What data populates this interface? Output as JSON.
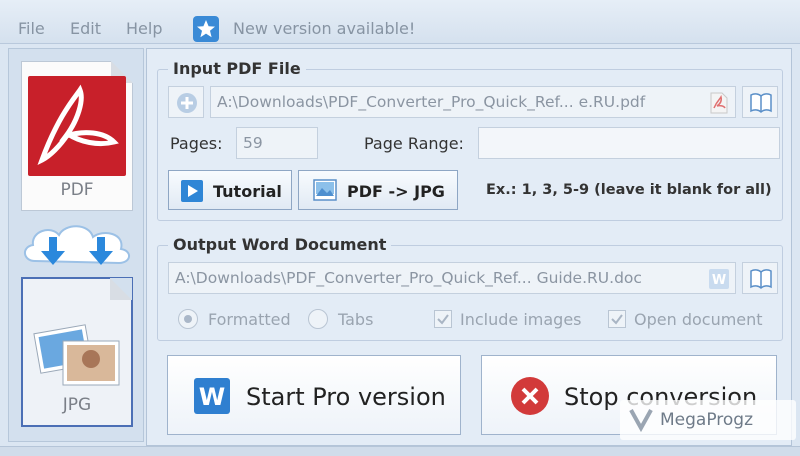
{
  "menu": {
    "file": "File",
    "edit": "Edit",
    "help": "Help",
    "update_notice": "New version available!"
  },
  "left_rail": {
    "pdf_label": "PDF",
    "jpg_label": "JPG"
  },
  "input_group": {
    "title": "Input PDF File",
    "file_path": "A:\\Downloads\\PDF_Converter_Pro_Quick_Ref... e.RU.pdf",
    "pages_label": "Pages:",
    "pages_value": "59",
    "range_label": "Page Range:",
    "range_value": "",
    "tutorial_label": "Tutorial",
    "mode_label": "PDF -> JPG",
    "range_hint": "Ex.: 1, 3, 5-9  (leave it blank for all)"
  },
  "output_group": {
    "title": "Output Word Document",
    "file_path": "A:\\Downloads\\PDF_Converter_Pro_Quick_Ref... Guide.RU.doc",
    "opt_formatted": "Formatted",
    "opt_tabs": "Tabs",
    "opt_include_images": "Include images",
    "opt_open_document": "Open document"
  },
  "actions": {
    "start_label": "Start Pro version",
    "stop_label": "Stop conversion"
  },
  "watermark": "MegaProgz",
  "colors": {
    "accent": "#2f7fd0",
    "stop_red": "#d23a3a",
    "pdf_red": "#c8202a"
  }
}
